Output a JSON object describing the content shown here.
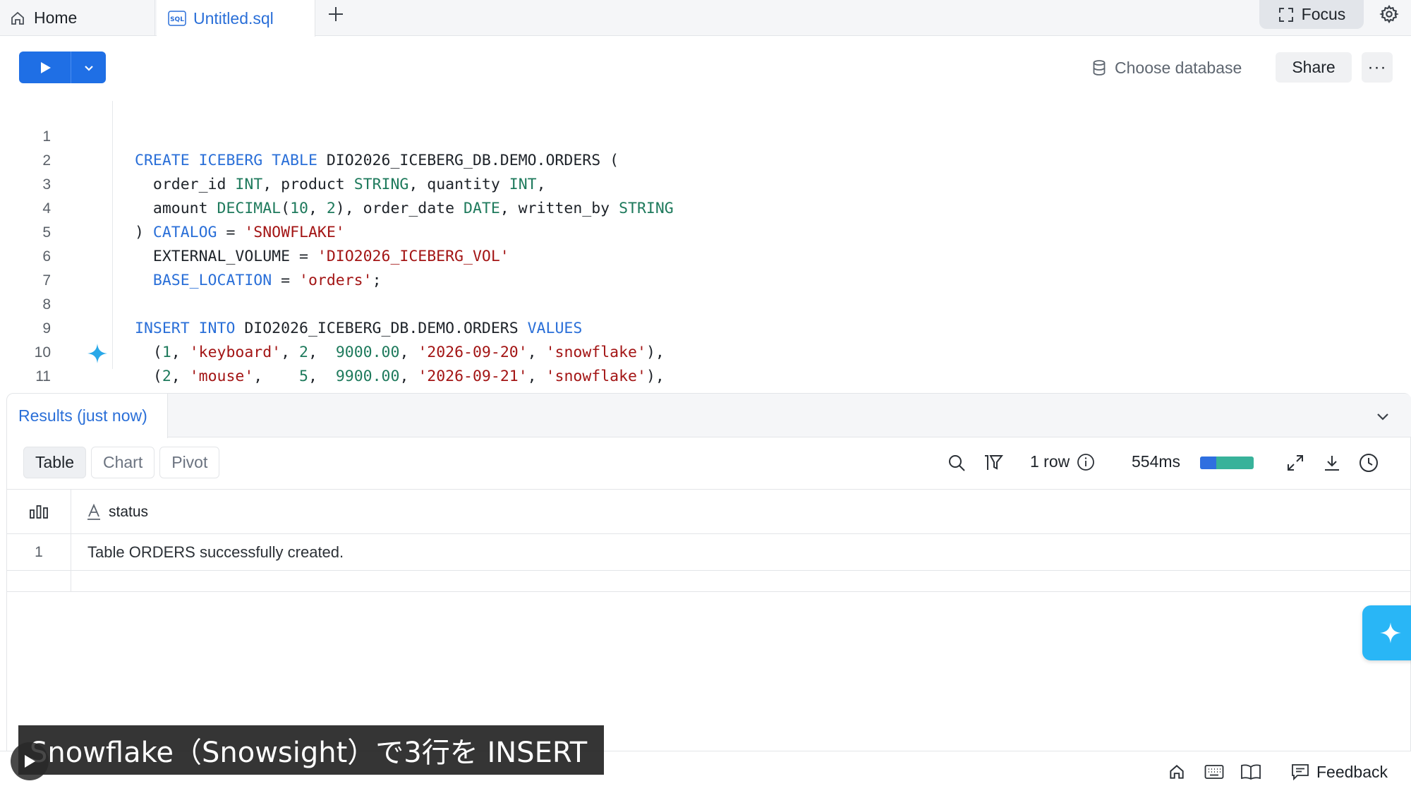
{
  "tabs": {
    "home_label": "Home",
    "sql_label": "Untitled.sql"
  },
  "header": {
    "focus_label": "Focus"
  },
  "toolbar": {
    "choose_db_label": "Choose database",
    "share_label": "Share",
    "more_label": "···"
  },
  "editor": {
    "line_numbers": [
      "1",
      "2",
      "3",
      "4",
      "5",
      "6",
      "7",
      "8",
      "9",
      "10",
      "11"
    ]
  },
  "results": {
    "tab_label": "Results (just now)",
    "views": [
      "Table",
      "Chart",
      "Pivot"
    ],
    "row_count": "1 row",
    "timing": "554ms",
    "timing_bar_fraction": 0.3,
    "column_header": "status",
    "rows": [
      {
        "index": "1",
        "status": "Table ORDERS successfully created."
      }
    ]
  },
  "statusbar": {
    "feedback_label": "Feedback"
  },
  "overlay": {
    "caption": "Snowflake（Snowsight）で3行を INSERT"
  },
  "colors": {
    "accent": "#1f6fe5",
    "link": "#2a6fd8",
    "ai": "#29b6f6"
  }
}
